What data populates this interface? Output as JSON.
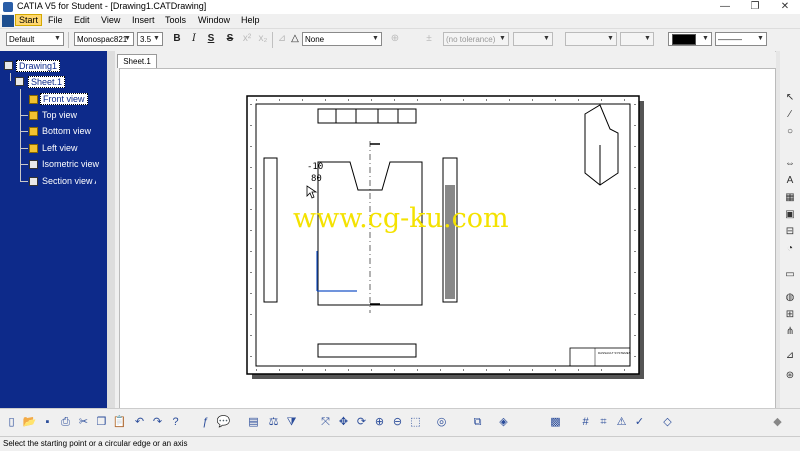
{
  "window": {
    "title": "CATIA V5 for Student - [Drawing1.CATDrawing]",
    "minimize": "—",
    "maximize": "❐",
    "close": "✕"
  },
  "menu": [
    {
      "label": "Start"
    },
    {
      "label": "File"
    },
    {
      "label": "Edit"
    },
    {
      "label": "View"
    },
    {
      "label": "Insert"
    },
    {
      "label": "Tools"
    },
    {
      "label": "Window"
    },
    {
      "label": "Help"
    }
  ],
  "toolbar": {
    "style_value": "Default",
    "font_value": "Monospac821",
    "size_value": "3.5",
    "bold": "B",
    "italic": "I",
    "underline": "S",
    "strike": "S",
    "frame_value": "None",
    "tolerance_value": "(no tolerance)",
    "line_color": "#000000",
    "line_type": "———"
  },
  "tree": {
    "root": "Drawing1",
    "sheet": "Sheet.1",
    "views": [
      "Front view",
      "Top view",
      "Bottom view",
      "Left view",
      "Isometric view",
      "Section view A"
    ]
  },
  "tabs": [
    "Sheet.1"
  ],
  "drawing": {
    "dim_top": "-10",
    "dim_bottom": "80",
    "title_block": "DASSAULT SYSTEMES"
  },
  "watermark": "www.cg-ku.com",
  "status": "Select the starting point or a circular edge or an axis",
  "icons": {
    "right": [
      "pointer-icon",
      "line-icon",
      "circle-icon",
      "dimension-icon",
      "annotation-icon",
      "table-icon",
      "view-icon",
      "section-icon",
      "detail-icon",
      "clip-icon",
      "balloon-icon",
      "datum-icon",
      "weld-icon",
      "symbol-icon",
      "dress-icon"
    ],
    "bottom": [
      "new-icon",
      "open-icon",
      "save-icon",
      "print-icon",
      "cut-icon",
      "copy-icon",
      "paste-icon",
      "undo-icon",
      "redo-icon",
      "whatsthis-icon",
      "formula-icon",
      "chat-icon",
      "layer-icon",
      "measure-icon",
      "filter-icon",
      "fit-icon",
      "pan-icon",
      "rotate-icon",
      "zoom-in-icon",
      "zoom-out-icon",
      "normal-view-icon",
      "hide-show-icon",
      "swap-icon",
      "render-icon",
      "grid-icon",
      "snap-icon",
      "analysis-icon",
      "catia-logo-icon"
    ]
  },
  "accent": "#0d2a8a",
  "highlight": "#ffd76e"
}
